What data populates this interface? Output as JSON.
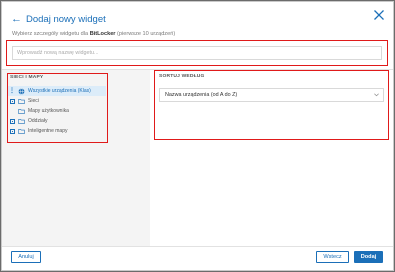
{
  "header": {
    "back_glyph": "←",
    "title": "Dodaj nowy widget",
    "subtitle_prefix": "Wybierz szczegóły widgetu dla ",
    "subtitle_bold": "BitLocker",
    "subtitle_suffix": " (pierwsze 10 urządzeń)"
  },
  "name_input": {
    "placeholder": "Wprowadź nową nazwę widgetu..."
  },
  "left_panel": {
    "title": "SIECI I MAPY",
    "items": [
      {
        "label": "Wszystkie urządzenia (Klas)",
        "icon": "globe-icon",
        "selected": true
      },
      {
        "label": "Sieci",
        "icon": "folder-icon",
        "expandable": true
      },
      {
        "label": "Mapy użytkownika",
        "icon": "folder-icon",
        "expandable": false
      },
      {
        "label": "Oddziały",
        "icon": "folder-icon",
        "expandable": true
      },
      {
        "label": "Inteligentne mapy",
        "icon": "folder-icon",
        "expandable": true
      }
    ]
  },
  "right_panel": {
    "title": "SORTUJ WEDŁUG",
    "sort_value": "Nazwa urządzenia (od A do Z)"
  },
  "footer": {
    "cancel_label": "Anuluj",
    "back_label": "Wstecz",
    "add_label": "Dodaj"
  },
  "colors": {
    "accent": "#1b6fb8",
    "highlight": "#e01a1a"
  }
}
